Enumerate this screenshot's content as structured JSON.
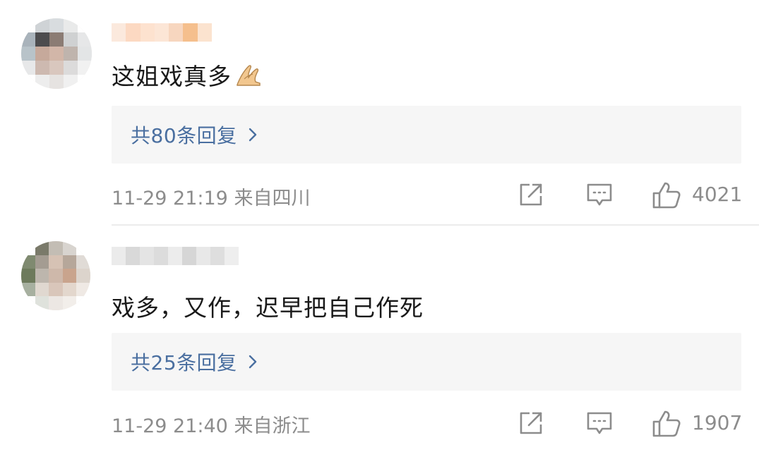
{
  "comments": [
    {
      "text": "这姐戏真多",
      "emoji": "praying-hands-icon",
      "replies_label": "共80条回复",
      "time": "11-29 21:19",
      "location": "来自四川",
      "likes": "4021"
    },
    {
      "text": "戏多，又作，迟早把自己作死",
      "replies_label": "共25条回复",
      "time": "11-29 21:40",
      "location": "来自浙江",
      "likes": "1907"
    }
  ],
  "colors": {
    "reply_link": "#4a6fa0",
    "meta_text": "#8c8c8c",
    "reply_box_bg": "#f6f6f6"
  }
}
